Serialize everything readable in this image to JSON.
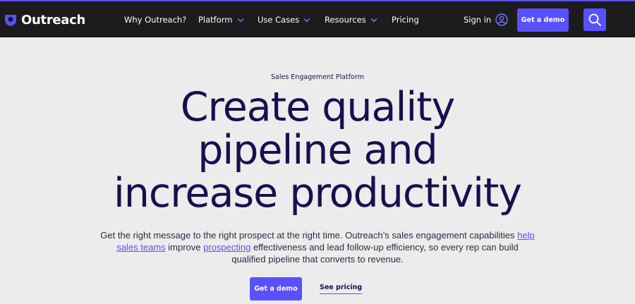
{
  "nav": {
    "brand": "Outreach",
    "brand_icon": "outreach-logo-icon",
    "items": [
      {
        "label": "Why Outreach?",
        "has_dropdown": false
      },
      {
        "label": "Platform",
        "has_dropdown": true
      },
      {
        "label": "Use Cases",
        "has_dropdown": true
      },
      {
        "label": "Resources",
        "has_dropdown": true
      },
      {
        "label": "Pricing",
        "has_dropdown": false
      }
    ],
    "sign_in": "Sign in",
    "demo_button": "Get a demo",
    "search_icon": "search-icon"
  },
  "hero": {
    "eyebrow": "Sales Engagement Platform",
    "headline_lines": [
      "Create quality",
      "pipeline and",
      "increase productivity"
    ],
    "description": {
      "part1": "Get the right message to the right prospect at the right time. Outreach’s sales engagement capabilities ",
      "link1": "help sales teams",
      "part2": " improve ",
      "link2": "prospecting",
      "part3": " effectiveness and lead follow-up efficiency, so every rep can build qualified pipeline that converts to revenue."
    },
    "primary_cta": "Get a demo",
    "secondary_cta": "See pricing"
  },
  "colors": {
    "accent": "#5951ff",
    "nav_background": "#1c1b1d",
    "page_background": "#ececec",
    "headline": "#17104f"
  }
}
